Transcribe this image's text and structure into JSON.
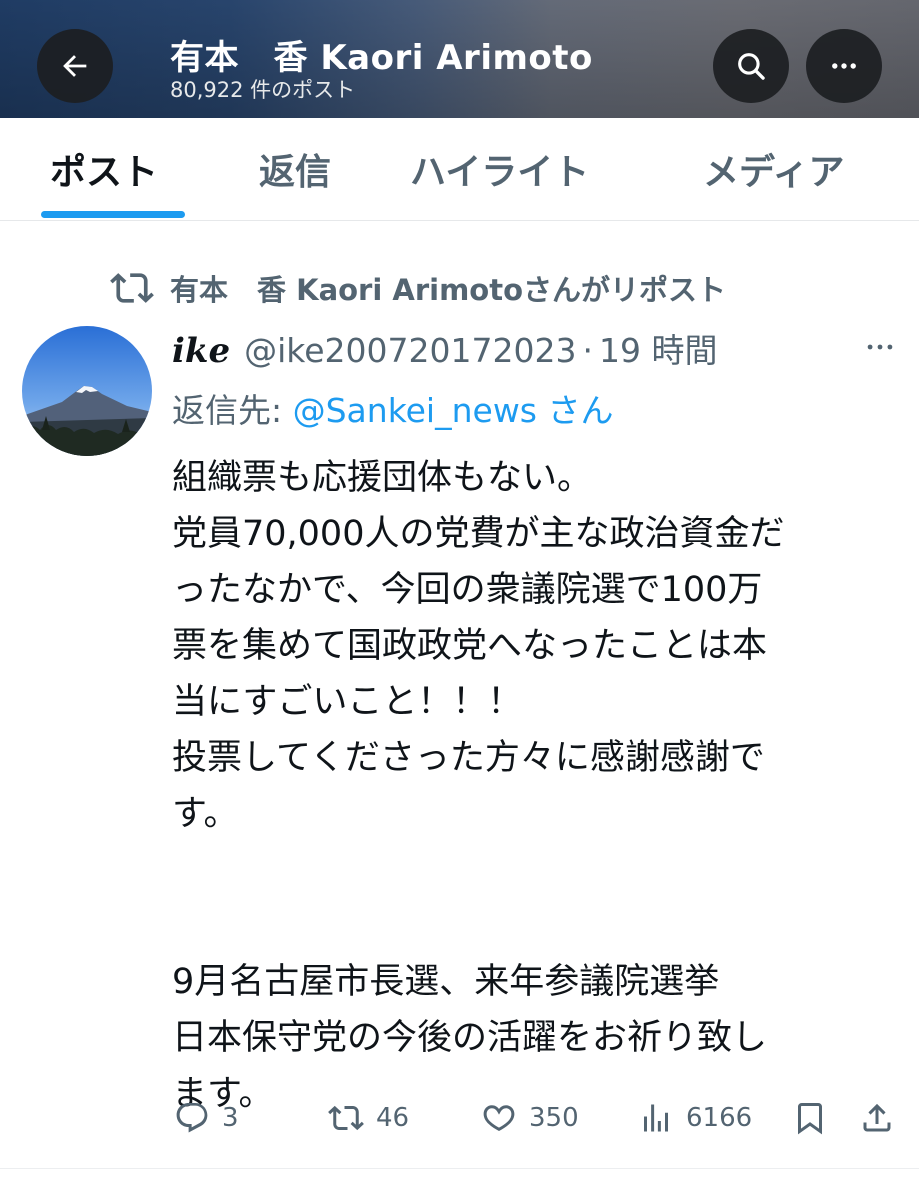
{
  "header": {
    "title": "有本　香  Kaori Arimoto",
    "post_count": "80,922 件のポスト",
    "back_icon": "back-arrow-icon",
    "search_icon": "search-icon",
    "more_icon": "more-horizontal-icon"
  },
  "tabs": [
    {
      "label": "ポスト",
      "active": true
    },
    {
      "label": "返信",
      "active": false
    },
    {
      "label": "ハイライト",
      "active": false
    },
    {
      "label": "メディア",
      "active": false
    }
  ],
  "colors": {
    "accent": "#1d9bf0",
    "secondary_text": "#536471",
    "primary_text": "#0f1419"
  },
  "post": {
    "repost_label": "有本　香  Kaori Arimotoさんがリポスト",
    "author_name": "𝒊𝒌𝒆",
    "author_handle": "@ike200720172023",
    "separator": "·",
    "time": "19 時間",
    "reply_label": "返信先: ",
    "reply_target": "@Sankei_news さん",
    "body_lines": [
      "組織票も応援団体もない。",
      "党員70,000人の党費が主な政治資金だ",
      "ったなかで、今回の衆議院選で100万",
      "票を集めて国政政党へなったことは本",
      "当にすごいこと！！！",
      "投票してくださった方々に感謝感謝で",
      "す。"
    ],
    "body_lines_2": [
      "9月名古屋市長選、来年参議院選挙",
      "日本保守党の今後の活躍をお祈り致し",
      "ます。"
    ],
    "stats": {
      "replies": "3",
      "reposts": "46",
      "likes": "350",
      "views": "6166"
    }
  }
}
